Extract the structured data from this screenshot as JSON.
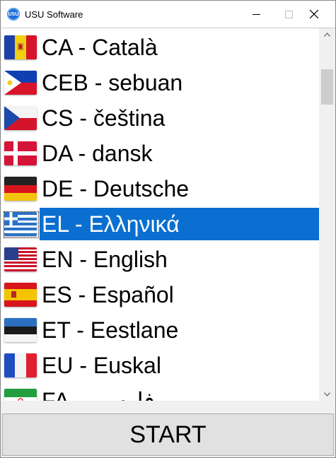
{
  "window": {
    "title": "USU Software",
    "app_icon_text": "USU",
    "icon_names": [
      "usu-logo-icon",
      "minimize-icon",
      "maximize-icon",
      "close-icon"
    ]
  },
  "languages": [
    {
      "label": "CA - Català",
      "flag": "andorra-flag-icon",
      "selected": false
    },
    {
      "label": "CEB - sebuan",
      "flag": "philippines-flag-icon",
      "selected": false
    },
    {
      "label": "CS - čeština",
      "flag": "czech-flag-icon",
      "selected": false
    },
    {
      "label": "DA - dansk",
      "flag": "denmark-flag-icon",
      "selected": false
    },
    {
      "label": "DE - Deutsche",
      "flag": "germany-flag-icon",
      "selected": false
    },
    {
      "label": "EL - Ελληνικά",
      "flag": "greece-flag-icon",
      "selected": true
    },
    {
      "label": "EN - English",
      "flag": "usa-flag-icon",
      "selected": false
    },
    {
      "label": "ES - Español",
      "flag": "spain-flag-icon",
      "selected": false
    },
    {
      "label": "ET - Eestlane",
      "flag": "estonia-flag-icon",
      "selected": false
    },
    {
      "label": "EU - Euskal",
      "flag": "france-flag-icon",
      "selected": false
    },
    {
      "label": "FA - فارسی",
      "flag": "iran-flag-icon",
      "selected": false
    }
  ],
  "start_button": {
    "label": "START"
  },
  "colors": {
    "selection": "#0a6fd0",
    "button_bg": "#e1e1e1"
  }
}
